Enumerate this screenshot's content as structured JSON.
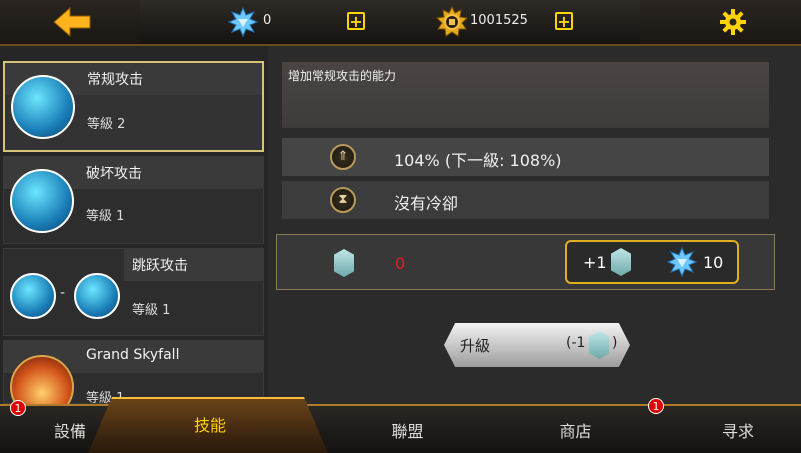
{
  "header": {
    "diamonds": "0",
    "coins": "1001525"
  },
  "skills": [
    {
      "name": "常规攻击",
      "level": "等級 2"
    },
    {
      "name": "破坏攻击",
      "level": "等級 1"
    },
    {
      "name": "跳跃攻击",
      "level": "等級 1",
      "separator": "-"
    },
    {
      "name": "Grand Skyfall",
      "level": "等級 1"
    }
  ],
  "detail": {
    "description": "增加常规攻击的能力",
    "stat_power": "104% (下一級: 108%)",
    "stat_cooldown": "沒有冷卻",
    "owned": "0",
    "reward_plus": "+1",
    "reward_cost": "10",
    "upgrade_label": "升級",
    "upgrade_cost_open": "(-1",
    "upgrade_cost_close": ")"
  },
  "tabs": [
    {
      "label": "設備",
      "badge": "1"
    },
    {
      "label": "技能"
    },
    {
      "label": "聯盟"
    },
    {
      "label": "商店"
    },
    {
      "label": "寻求",
      "badge": "1"
    }
  ],
  "colors": {
    "accent": "#ffd200",
    "badge": "#dd0000",
    "zero": "#e02020"
  }
}
